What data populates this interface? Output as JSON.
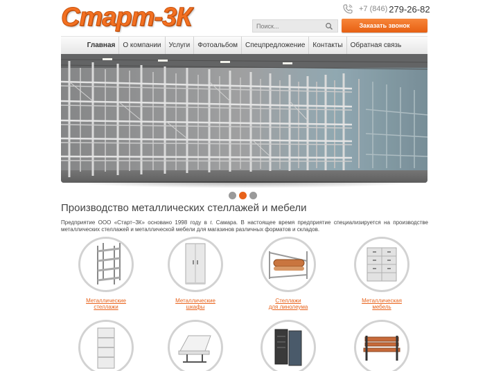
{
  "header": {
    "logo_text": "Старт-3К",
    "phone_code": "+7 (846)",
    "phone_number": "279-26-82",
    "search_placeholder": "Поиск...",
    "callback_label": "Заказать звонок"
  },
  "nav": {
    "items": [
      {
        "label": "Главная",
        "active": true
      },
      {
        "label": "О компании"
      },
      {
        "label": "Услуги"
      },
      {
        "label": "Фотоальбом"
      },
      {
        "label": "Спецпредложение"
      },
      {
        "label": "Контакты"
      },
      {
        "label": "Обратная связь"
      }
    ]
  },
  "slider": {
    "dots": 3,
    "active_dot": 2
  },
  "content": {
    "title": "Производство металлических стеллажей и мебели",
    "intro": "Предприятие ООО «Старт–3К» основано 1998 году в г. Самара. В настоящее время предприятие специализируется на производстве металлических стеллажей и металлической мебели для магазинов различных форматов и складов."
  },
  "products": [
    {
      "line1": "Металлические",
      "line2": "стеллажи",
      "icon": "metal-shelving-icon"
    },
    {
      "line1": "Металлические",
      "line2": "шкафы",
      "icon": "metal-cabinet-icon"
    },
    {
      "line1": "Стеллажи",
      "line2": "для линолеума",
      "icon": "linoleum-rack-icon"
    },
    {
      "line1": "Металлическая",
      "line2": "мебель",
      "icon": "metal-furniture-icon"
    },
    {
      "line1": "",
      "line2": "",
      "icon": "shop-shelf-icon"
    },
    {
      "line1": "",
      "line2": "",
      "icon": "bench-seating-icon"
    },
    {
      "line1": "",
      "line2": "",
      "icon": "server-cabinet-icon"
    },
    {
      "line1": "",
      "line2": "",
      "icon": "park-bench-icon"
    }
  ],
  "colors": {
    "accent": "#e8621a",
    "nav_bg": "#ececec",
    "circle_border": "#d2d2d2"
  }
}
